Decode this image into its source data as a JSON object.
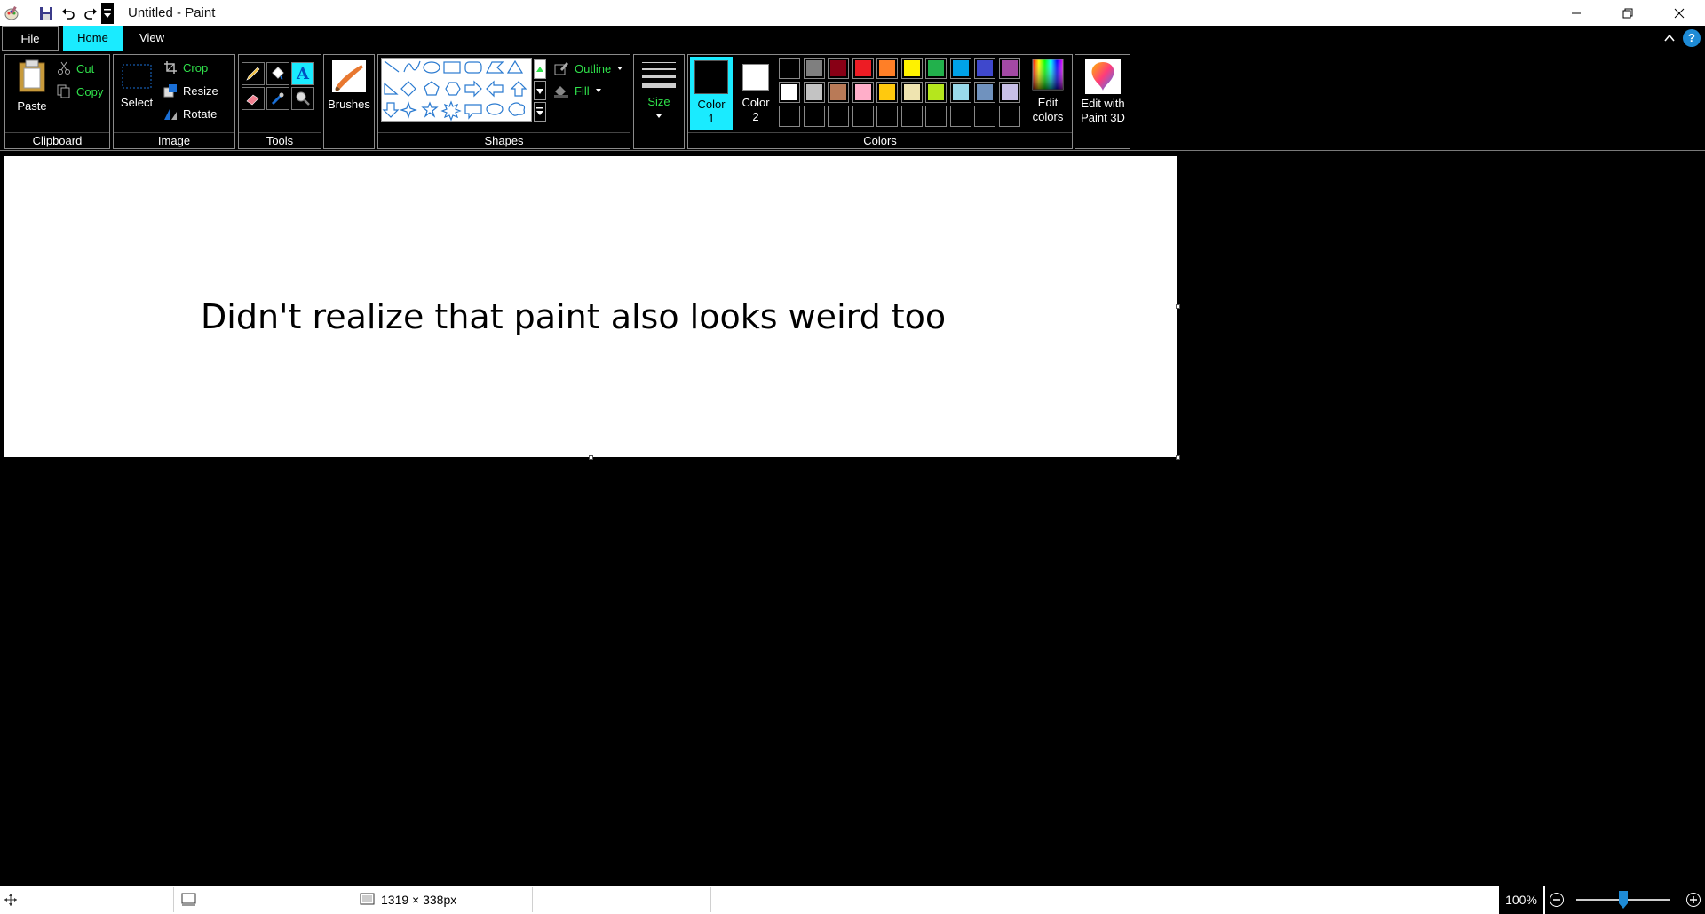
{
  "window": {
    "title": "Untitled - Paint"
  },
  "tabs": {
    "file": "File",
    "home": "Home",
    "view": "View"
  },
  "help": "?",
  "ribbon": {
    "clipboard": {
      "label": "Clipboard",
      "paste": "Paste",
      "cut": "Cut",
      "copy": "Copy"
    },
    "image": {
      "label": "Image",
      "select": "Select",
      "crop": "Crop",
      "resize": "Resize",
      "rotate": "Rotate"
    },
    "tools": {
      "label": "Tools"
    },
    "brushes": {
      "label": "Brushes"
    },
    "shapes": {
      "label": "Shapes",
      "outline": "Outline",
      "fill": "Fill"
    },
    "size": {
      "label": "Size"
    },
    "colors": {
      "label": "Colors",
      "color1": "Color 1",
      "color2": "Color 2",
      "edit_colors": "Edit colors",
      "edit_paint3d": "Edit with Paint 3D",
      "color1_value": "#000000",
      "color2_value": "#ffffff",
      "palette_row1": [
        "#000000",
        "#7f7f7f",
        "#880015",
        "#ed1c24",
        "#ff7f27",
        "#fff200",
        "#22b14c",
        "#00a2e8",
        "#3f48cc",
        "#a349a4"
      ],
      "palette_row2": [
        "#ffffff",
        "#c3c3c3",
        "#b97a57",
        "#ffaec9",
        "#ffc90e",
        "#efe4b0",
        "#b5e61d",
        "#99d9ea",
        "#7092be",
        "#c8bfe7"
      ]
    }
  },
  "canvas": {
    "text": "Didn't realize that paint also looks weird too"
  },
  "status": {
    "dimensions": "1319 × 338px",
    "zoom": "100%",
    "zoom_level": 0.5
  }
}
